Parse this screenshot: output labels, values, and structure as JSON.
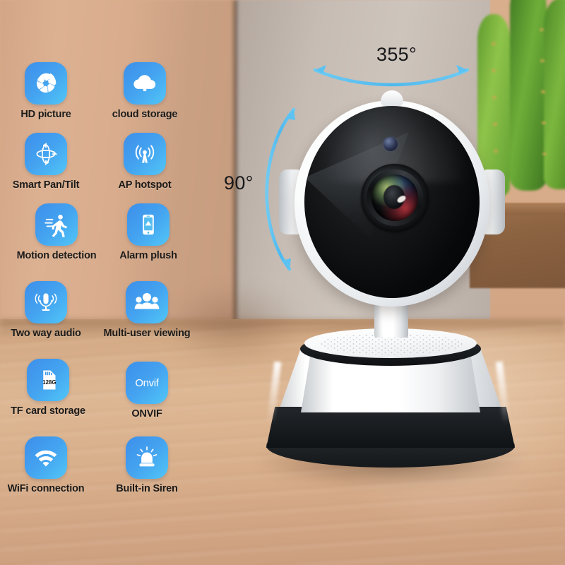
{
  "scene": {
    "type": "product-photo",
    "subject": "wireless-ptz-security-camera",
    "background": "wooden-desk-with-grey-wall-and-cactus-plant"
  },
  "colors": {
    "icon_tile_gradient_start": "#3d8fea",
    "icon_tile_gradient_end": "#51c6f7",
    "arrow_blue": "#58bff0",
    "label_text": "#1c1a18",
    "annotation_text": "#18181a",
    "desk_wood": "#d9b08c",
    "wall_grey": "#c6bcb3",
    "camera_white": "#ffffff",
    "camera_black": "#0d0f11"
  },
  "annotations": [
    {
      "id": "pan",
      "value": "355°",
      "name": "horizontal-pan-range"
    },
    {
      "id": "tilt",
      "value": "90°",
      "name": "vertical-tilt-range"
    }
  ],
  "features": [
    {
      "icon": "aperture-icon",
      "label": "HD picture",
      "col": 0,
      "row": 0
    },
    {
      "icon": "cloud-upload-icon",
      "label": "cloud storage",
      "col": 1,
      "row": 0
    },
    {
      "icon": "pan-tilt-icon",
      "label": "Smart Pan/Tilt",
      "col": 0,
      "row": 1
    },
    {
      "icon": "antenna-icon",
      "label": "AP hotspot",
      "col": 1,
      "row": 1
    },
    {
      "icon": "running-man-icon",
      "label": "Motion detection",
      "col": 0,
      "row": 2
    },
    {
      "icon": "phone-alert-icon",
      "label": "Alarm plush",
      "col": 1,
      "row": 2
    },
    {
      "icon": "microphone-icon",
      "label": "Two way audio",
      "col": 0,
      "row": 3
    },
    {
      "icon": "users-group-icon",
      "label": "Multi-user viewing",
      "col": 1,
      "row": 3
    },
    {
      "icon": "sd-card-icon",
      "label": "TF card storage",
      "col": 0,
      "row": 4
    },
    {
      "icon": "onvif-logo-icon",
      "label": "ONVIF",
      "col": 1,
      "row": 4
    },
    {
      "icon": "wifi-icon",
      "label": "WiFi connection",
      "col": 0,
      "row": 5
    },
    {
      "icon": "siren-icon",
      "label": "Built-in Siren",
      "col": 1,
      "row": 5
    }
  ],
  "sd_card": {
    "capacity_label": "128G"
  },
  "onvif": {
    "wordmark": "Onvif"
  }
}
